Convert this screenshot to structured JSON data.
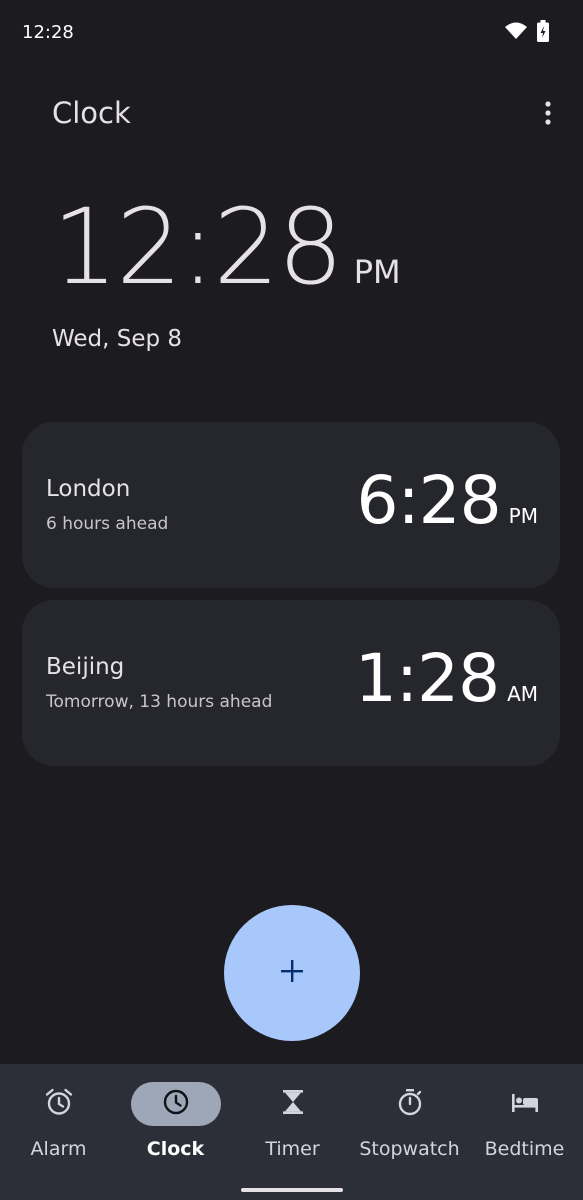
{
  "status_bar": {
    "time": "12:28",
    "icons": [
      "wifi-icon",
      "battery-icon"
    ]
  },
  "app_bar": {
    "title": "Clock",
    "overflow_icon": "more-vert-icon"
  },
  "main_clock": {
    "time": "12:28",
    "ampm": "PM",
    "date": "Wed, Sep 8"
  },
  "world_clocks": [
    {
      "city": "London",
      "offset": "6 hours ahead",
      "time": "6:28",
      "ampm": "PM"
    },
    {
      "city": "Beijing",
      "offset": "Tomorrow, 13 hours ahead",
      "time": "1:28",
      "ampm": "AM"
    }
  ],
  "fab": {
    "label": "+",
    "icon": "add-icon",
    "color": "#a8c7fa"
  },
  "bottom_nav": {
    "items": [
      {
        "label": "Alarm",
        "icon": "alarm-icon",
        "active": false
      },
      {
        "label": "Clock",
        "icon": "clock-icon",
        "active": true
      },
      {
        "label": "Timer",
        "icon": "hourglass-icon",
        "active": false
      },
      {
        "label": "Stopwatch",
        "icon": "stopwatch-icon",
        "active": false
      },
      {
        "label": "Bedtime",
        "icon": "bed-icon",
        "active": false
      }
    ]
  },
  "colors": {
    "background": "#1c1b1f",
    "card": "#26262d",
    "nav_background": "#2d2f38",
    "active_pill": "#9da7b8",
    "accent": "#a8c7fa"
  }
}
